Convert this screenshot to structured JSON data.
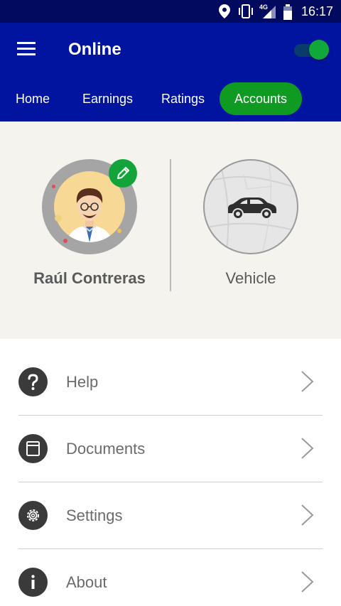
{
  "status_bar": {
    "time": "16:17",
    "network": "4G",
    "icons": [
      "location-icon",
      "vibrate-icon",
      "signal-icon",
      "battery-icon"
    ]
  },
  "app_bar": {
    "title": "Online",
    "online_toggle_on": true,
    "colors": {
      "background": "#0114a0",
      "accent": "#0f9a22"
    }
  },
  "tabs": [
    {
      "label": "Home",
      "active": false
    },
    {
      "label": "Earnings",
      "active": false
    },
    {
      "label": "Ratings",
      "active": false
    },
    {
      "label": "Accounts",
      "active": true
    }
  ],
  "profile": {
    "name": "Raúl Contreras",
    "vehicle_label": "Vehicle"
  },
  "menu": [
    {
      "label": "Help",
      "icon": "help-icon"
    },
    {
      "label": "Documents",
      "icon": "documents-icon"
    },
    {
      "label": "Settings",
      "icon": "settings-icon"
    },
    {
      "label": "About",
      "icon": "info-icon"
    }
  ]
}
